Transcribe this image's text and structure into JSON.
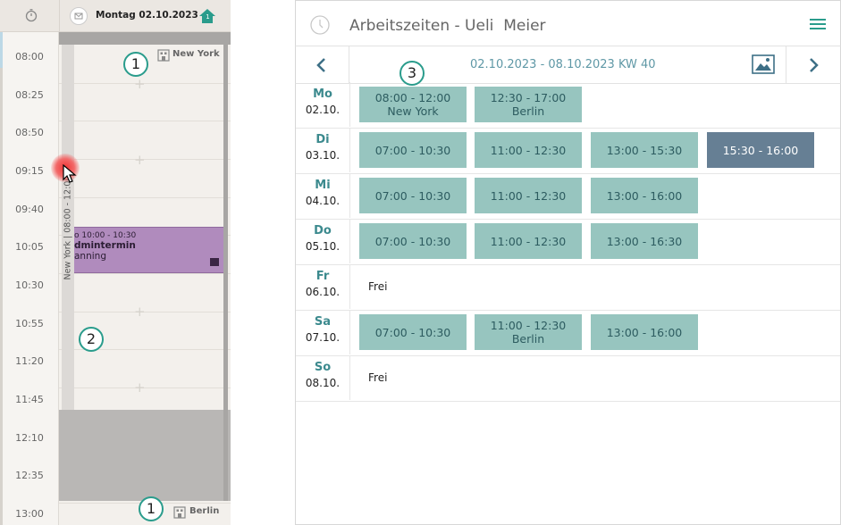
{
  "left_calendar": {
    "day_title": "Montag 02.10.2023",
    "home_badge": "1",
    "times": [
      "08:00",
      "08:25",
      "08:50",
      "09:15",
      "09:40",
      "10:05",
      "10:30",
      "10:55",
      "11:20",
      "11:45",
      "12:10",
      "12:35",
      "13:00"
    ],
    "availability_text": "New York | 08:00 - 12:00",
    "location_top": "New York",
    "location_bottom": "Berlin",
    "appointment": {
      "time": "o 10:00 - 10:30",
      "title": "dmintermin",
      "subtitle": "anning"
    },
    "add_symbol": "+"
  },
  "callouts": [
    "1",
    "2",
    "3",
    "1"
  ],
  "schedule": {
    "title": "Arbeitszeiten - Ueli  Meier",
    "week_range": "02.10.2023 - 08.10.2023 KW 40",
    "days": [
      {
        "abbr": "Mo",
        "date": "02.10.",
        "slots": [
          {
            "time": "08:00 - 12:00",
            "loc": "New York"
          },
          {
            "time": "12:30 - 17:00",
            "loc": "Berlin"
          }
        ]
      },
      {
        "abbr": "Di",
        "date": "03.10.",
        "slots": [
          {
            "time": "07:00 - 10:30"
          },
          {
            "time": "11:00 - 12:30"
          },
          {
            "time": "13:00 - 15:30"
          },
          {
            "time": "15:30 - 16:00",
            "selected": true
          }
        ]
      },
      {
        "abbr": "Mi",
        "date": "04.10.",
        "slots": [
          {
            "time": "07:00 - 10:30"
          },
          {
            "time": "11:00 - 12:30"
          },
          {
            "time": "13:00 - 16:00"
          }
        ]
      },
      {
        "abbr": "Do",
        "date": "05.10.",
        "slots": [
          {
            "time": "07:00 - 10:30"
          },
          {
            "time": "11:00 - 12:30"
          },
          {
            "time": "13:00 - 16:30"
          }
        ]
      },
      {
        "abbr": "Fr",
        "date": "06.10.",
        "free": "Frei",
        "slots": []
      },
      {
        "abbr": "Sa",
        "date": "07.10.",
        "slots": [
          {
            "time": "07:00 - 10:30"
          },
          {
            "time": "11:00 - 12:30",
            "loc": "Berlin"
          },
          {
            "time": "13:00 - 16:00"
          }
        ]
      },
      {
        "abbr": "So",
        "date": "08.10.",
        "free": "Frei",
        "slots": []
      }
    ]
  },
  "colors": {
    "slot": "#97c5bf",
    "slot_selected": "#667f94",
    "accent": "#2a9c8c",
    "appointment": "#b08bbd",
    "day_label": "#3c8a8e"
  },
  "icons": [
    "stopwatch-icon",
    "mail-icon",
    "home-icon",
    "building-icon",
    "clock-icon",
    "menu-icon",
    "chevron-left-icon",
    "chevron-right-icon",
    "image-icon",
    "cursor-icon"
  ]
}
